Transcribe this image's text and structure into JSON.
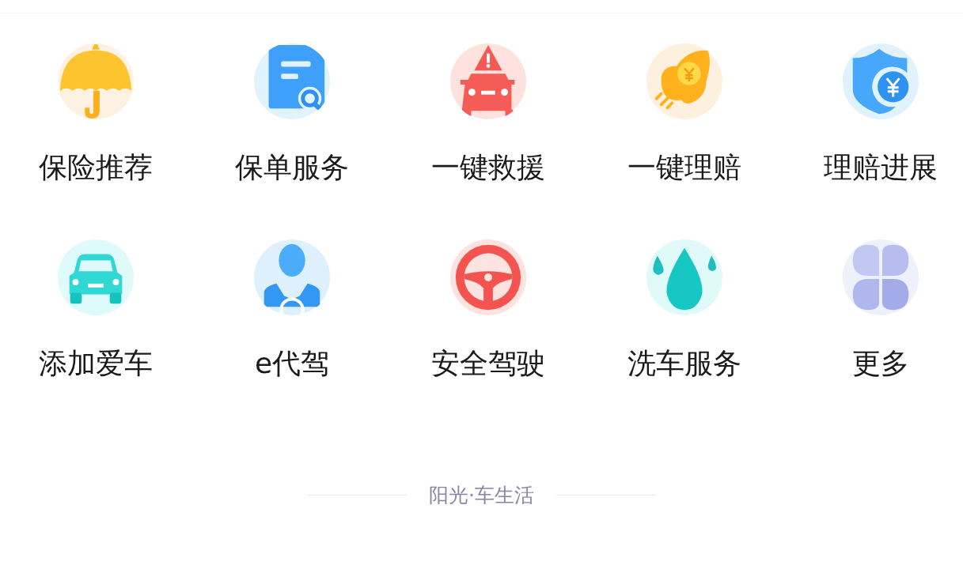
{
  "services": [
    {
      "label": "保险推荐",
      "kind": "umbrella"
    },
    {
      "label": "保单服务",
      "kind": "policy"
    },
    {
      "label": "一键救援",
      "kind": "rescue"
    },
    {
      "label": "一键理赔",
      "kind": "claim"
    },
    {
      "label": "理赔进展",
      "kind": "progress"
    },
    {
      "label": "添加爱车",
      "kind": "car"
    },
    {
      "label": "e代驾",
      "kind": "driver"
    },
    {
      "label": "安全驾驶",
      "kind": "wheel"
    },
    {
      "label": "洗车服务",
      "kind": "wash"
    },
    {
      "label": "更多",
      "kind": "more"
    }
  ],
  "footer": "阳光·车生活"
}
